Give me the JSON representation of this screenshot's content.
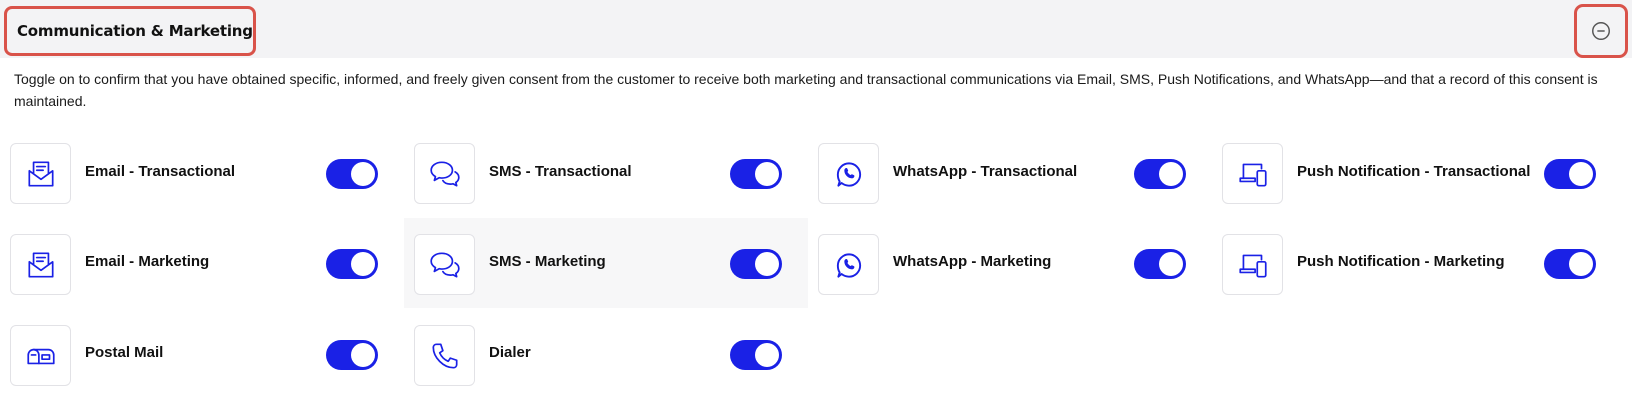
{
  "section": {
    "title": "Communication & Marketing",
    "collapse_icon": "minus-circle-icon",
    "description": "Toggle on to confirm that you have obtained specific, informed, and freely given consent from the customer to receive both marketing and transactional communications via Email, SMS, Push Notifications, and WhatsApp—and that a record of this consent is maintained."
  },
  "colors": {
    "accent": "#1a21e6",
    "highlight_border": "#d9534a",
    "header_bg": "#f3f3f5"
  },
  "channels": [
    {
      "label": "Email - Transactional",
      "icon": "email-icon",
      "enabled": true
    },
    {
      "label": "SMS - Transactional",
      "icon": "chat-bubbles-icon",
      "enabled": true
    },
    {
      "label": "WhatsApp - Transactional",
      "icon": "whatsapp-icon",
      "enabled": true
    },
    {
      "label": "Push Notification - Transactional",
      "icon": "devices-icon",
      "enabled": true
    },
    {
      "label": "Email - Marketing",
      "icon": "email-icon",
      "enabled": true
    },
    {
      "label": "SMS - Marketing",
      "icon": "chat-bubbles-icon",
      "enabled": true
    },
    {
      "label": "WhatsApp - Marketing",
      "icon": "whatsapp-icon",
      "enabled": true
    },
    {
      "label": "Push Notification - Marketing",
      "icon": "devices-icon",
      "enabled": true
    },
    {
      "label": "Postal Mail",
      "icon": "mailbox-icon",
      "enabled": true
    },
    {
      "label": "Dialer",
      "icon": "phone-icon",
      "enabled": true
    }
  ]
}
